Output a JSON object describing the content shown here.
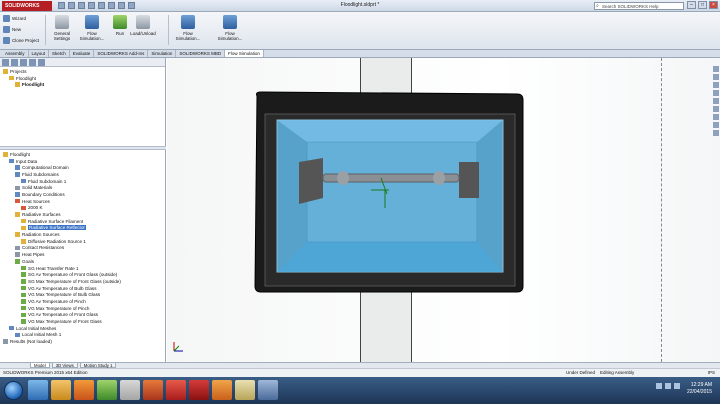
{
  "titlebar": {
    "logo": "SOLIDWORKS",
    "document": "Floodlight.sldprt *",
    "search_placeholder": "Search SOLIDWORKS Help",
    "minimize": "–",
    "maximize": "□",
    "close": "×"
  },
  "ribbon": {
    "small_items": [
      "Wizard",
      "New",
      "Clone Project"
    ],
    "buttons": [
      "General Settings",
      "Flow Simulation...",
      "Run",
      "Load/Unload",
      "Flow Simulation...",
      "Flow Simulation..."
    ]
  },
  "cmdtabs": [
    "Assembly",
    "Layout",
    "Sketch",
    "Evaluate",
    "SOLIDWORKS Add-Ins",
    "Simulation",
    "SOLIDWORKS MBD",
    "Flow Simulation"
  ],
  "upper_tree": [
    {
      "label": "Projects",
      "level": 0,
      "icon": "gold"
    },
    {
      "label": "Floodlight",
      "level": 1,
      "icon": "gold"
    },
    {
      "label": "Floodlight",
      "level": 2,
      "icon": "gold",
      "bold": true
    }
  ],
  "lower_tree": [
    {
      "label": "Floodlight",
      "level": 0,
      "icon": "gold"
    },
    {
      "label": "Input Data",
      "level": 1,
      "icon": "blue"
    },
    {
      "label": "Computational Domain",
      "level": 2,
      "icon": "blue"
    },
    {
      "label": "Fluid Subdomains",
      "level": 2,
      "icon": "blue"
    },
    {
      "label": "Fluid Subdomain 1",
      "level": 3,
      "icon": "blue"
    },
    {
      "label": "Solid Materials",
      "level": 2,
      "icon": "grey"
    },
    {
      "label": "Boundary Conditions",
      "level": 2,
      "icon": "blue"
    },
    {
      "label": "Heat Sources",
      "level": 2,
      "icon": "red"
    },
    {
      "label": "2000 K",
      "level": 3,
      "icon": "red"
    },
    {
      "label": "Radiative Surfaces",
      "level": 2,
      "icon": "gold"
    },
    {
      "label": "Radiative Surface Filament",
      "level": 3,
      "icon": "gold"
    },
    {
      "label": "Radiative Surface Reflector",
      "level": 3,
      "icon": "gold",
      "selected": true
    },
    {
      "label": "Radiation Sources",
      "level": 2,
      "icon": "gold"
    },
    {
      "label": "Diffusive Radiation Source 1",
      "level": 3,
      "icon": "gold"
    },
    {
      "label": "Contact Resistances",
      "level": 2,
      "icon": "grey"
    },
    {
      "label": "Heat Pipes",
      "level": 2,
      "icon": "grey"
    },
    {
      "label": "Goals",
      "level": 2,
      "icon": "green"
    },
    {
      "label": "SG Heat Transfer Rate 1",
      "level": 3,
      "icon": "green"
    },
    {
      "label": "SG Av Temperature of Front Glass (outside)",
      "level": 3,
      "icon": "green"
    },
    {
      "label": "SG Max Temperature of Front Glass (outside)",
      "level": 3,
      "icon": "green"
    },
    {
      "label": "VG Av Temperature of Bulb Glass",
      "level": 3,
      "icon": "green"
    },
    {
      "label": "VG Max Temperature of Bulb Glass",
      "level": 3,
      "icon": "green"
    },
    {
      "label": "VG Av Temperature of Pinch",
      "level": 3,
      "icon": "green"
    },
    {
      "label": "VG Max Temperature of Pinch",
      "level": 3,
      "icon": "green"
    },
    {
      "label": "VG Av Temperature of Front Glass",
      "level": 3,
      "icon": "green"
    },
    {
      "label": "VG Max Temperature of Front Glass",
      "level": 3,
      "icon": "green"
    },
    {
      "label": "Local Initial Meshes",
      "level": 1,
      "icon": "blue"
    },
    {
      "label": "Local Initial Mesh 1",
      "level": 2,
      "icon": "blue"
    },
    {
      "label": "Results (Not loaded)",
      "level": 0,
      "icon": "grey"
    }
  ],
  "bottom_tabs": [
    "Model",
    "3D Views",
    "Motion Study 1"
  ],
  "status": {
    "left": "SOLIDWORKS Premium 2015 x64 Edition",
    "mid": "Under Defined",
    "mid2": "Editing Assembly",
    "right": "IPS"
  },
  "clock": {
    "time": "12:29 AM",
    "date": "22/04/2015"
  },
  "colors": {
    "housing": "#1b1b1b",
    "glass": "#5fb8e8",
    "selection": "#3a73c6",
    "taskbar": "#2a4a72"
  }
}
